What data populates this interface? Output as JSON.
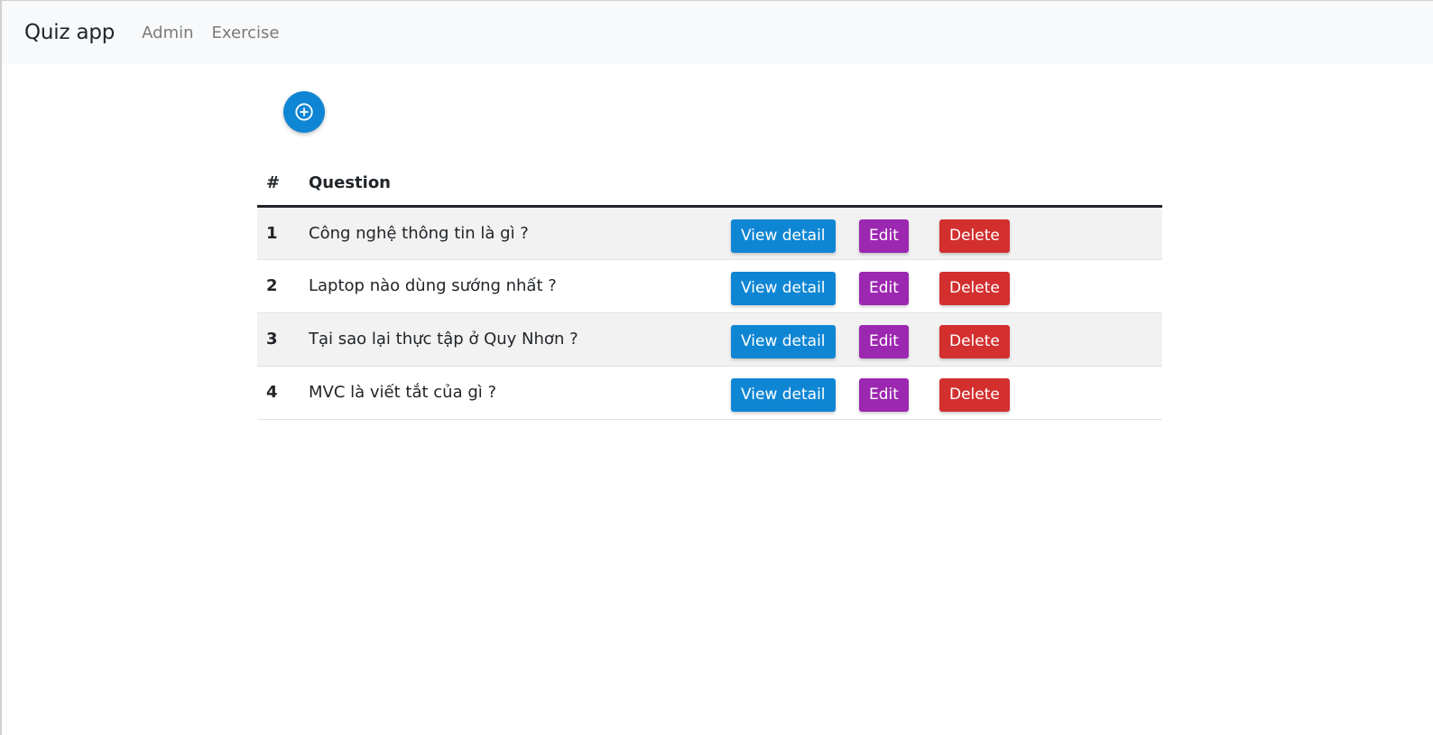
{
  "nav": {
    "brand": "Quiz app",
    "links": [
      "Admin",
      "Exercise"
    ]
  },
  "toolbar": {
    "add_icon": "plus-circle-icon"
  },
  "table": {
    "headers": [
      "#",
      "Question"
    ],
    "rows": [
      {
        "num": "1",
        "question": "Công nghệ thông tin là gì ?"
      },
      {
        "num": "2",
        "question": "Laptop nào dùng sướng nhất ?"
      },
      {
        "num": "3",
        "question": "Tại sao lại thực tập ở Quy Nhơn ?"
      },
      {
        "num": "4",
        "question": "MVC là viết tắt của gì ?"
      }
    ],
    "actions": {
      "view_label": "View detail",
      "edit_label": "Edit",
      "delete_label": "Delete"
    }
  },
  "colors": {
    "primary": "#0f86d4",
    "edit": "#9c27b0",
    "delete": "#d32f2f",
    "navbar_bg": "#f8f9fa"
  }
}
